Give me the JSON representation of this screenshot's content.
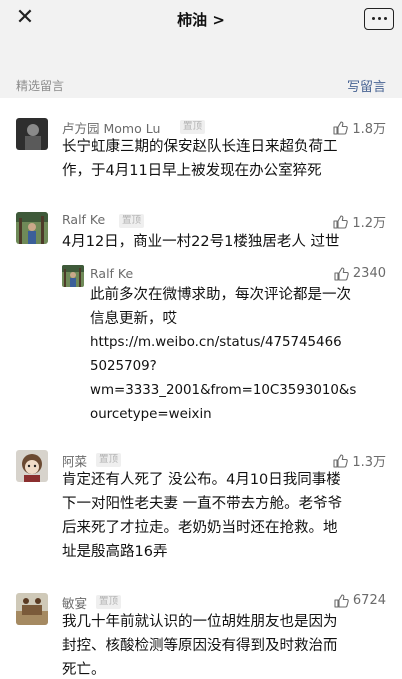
{
  "header": {
    "title": "柿油 >"
  },
  "section": {
    "left": "精选留言",
    "right": "写留言"
  },
  "comments": [
    {
      "name": "卢方园 Momo Lu",
      "badge": "置顶",
      "likes": "1.8万",
      "text": "长宁虹康三期的保安赵队长连日来超负荷工\n作，于4月11日早上被发现在办公室猝死"
    },
    {
      "name": "Ralf Ke",
      "badge": "置顶",
      "likes": "1.2万",
      "text": "4月12日，商业一村22号1楼独居老人 过世",
      "reply": {
        "name": "Ralf Ke",
        "likes": "2340",
        "text": "此前多次在微博求助，每次评论都是一次\n信息更新，哎",
        "url": "https://m.weibo.cn/status/475745466\n5025709?\nwm=3333_2001&from=10C3593010&s\nourcetype=weixin"
      }
    },
    {
      "name": "阿菜",
      "badge": "置顶",
      "likes": "1.3万",
      "text": "肯定还有人死了 没公布。4月10日我同事楼\n下一对阳性老夫妻 一直不带去方舱。老爷爷\n后来死了才拉走。老奶奶当时还在抢救。地\n址是殷高路16弄"
    },
    {
      "name": "敏宴",
      "badge": "置顶",
      "likes": "6724",
      "text": "我几十年前就认识的一位胡姓朋友也是因为\n封控、核酸检测等原因没有得到及时救治而\n死亡。"
    }
  ],
  "icons": {
    "close": "close-icon",
    "more": "more-icon",
    "like": "thumbs-up-icon"
  }
}
